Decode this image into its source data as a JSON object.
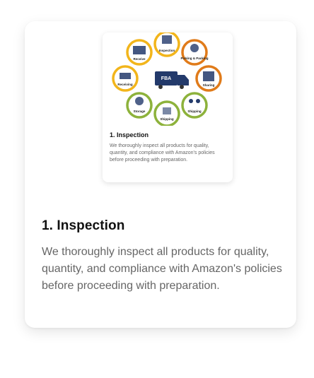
{
  "thumbnail": {
    "diagram_labels": {
      "center": "FBA",
      "receive": "Receive",
      "inspection": "Inspection",
      "picking": "Picking & Packing",
      "storage_left": "Receiving",
      "storing": "Storage",
      "shipping_bottom": "Shipping",
      "shipping_right": "Shipping",
      "sharing": "Sharing"
    },
    "title": "1. Inspection",
    "text": "We thoroughly inspect all products for quality, quantity, and compliance with Amazon's policies before proceeding with preparation."
  },
  "card": {
    "title": "1. Inspection",
    "description": "We thoroughly inspect all products for quality, quantity, and compliance with Amazon's policies before proceeding with preparation."
  },
  "colors": {
    "ring_yellow": "#f2b51b",
    "ring_orange": "#e07b1a",
    "ring_green": "#8db23b",
    "navy": "#233a6b"
  }
}
